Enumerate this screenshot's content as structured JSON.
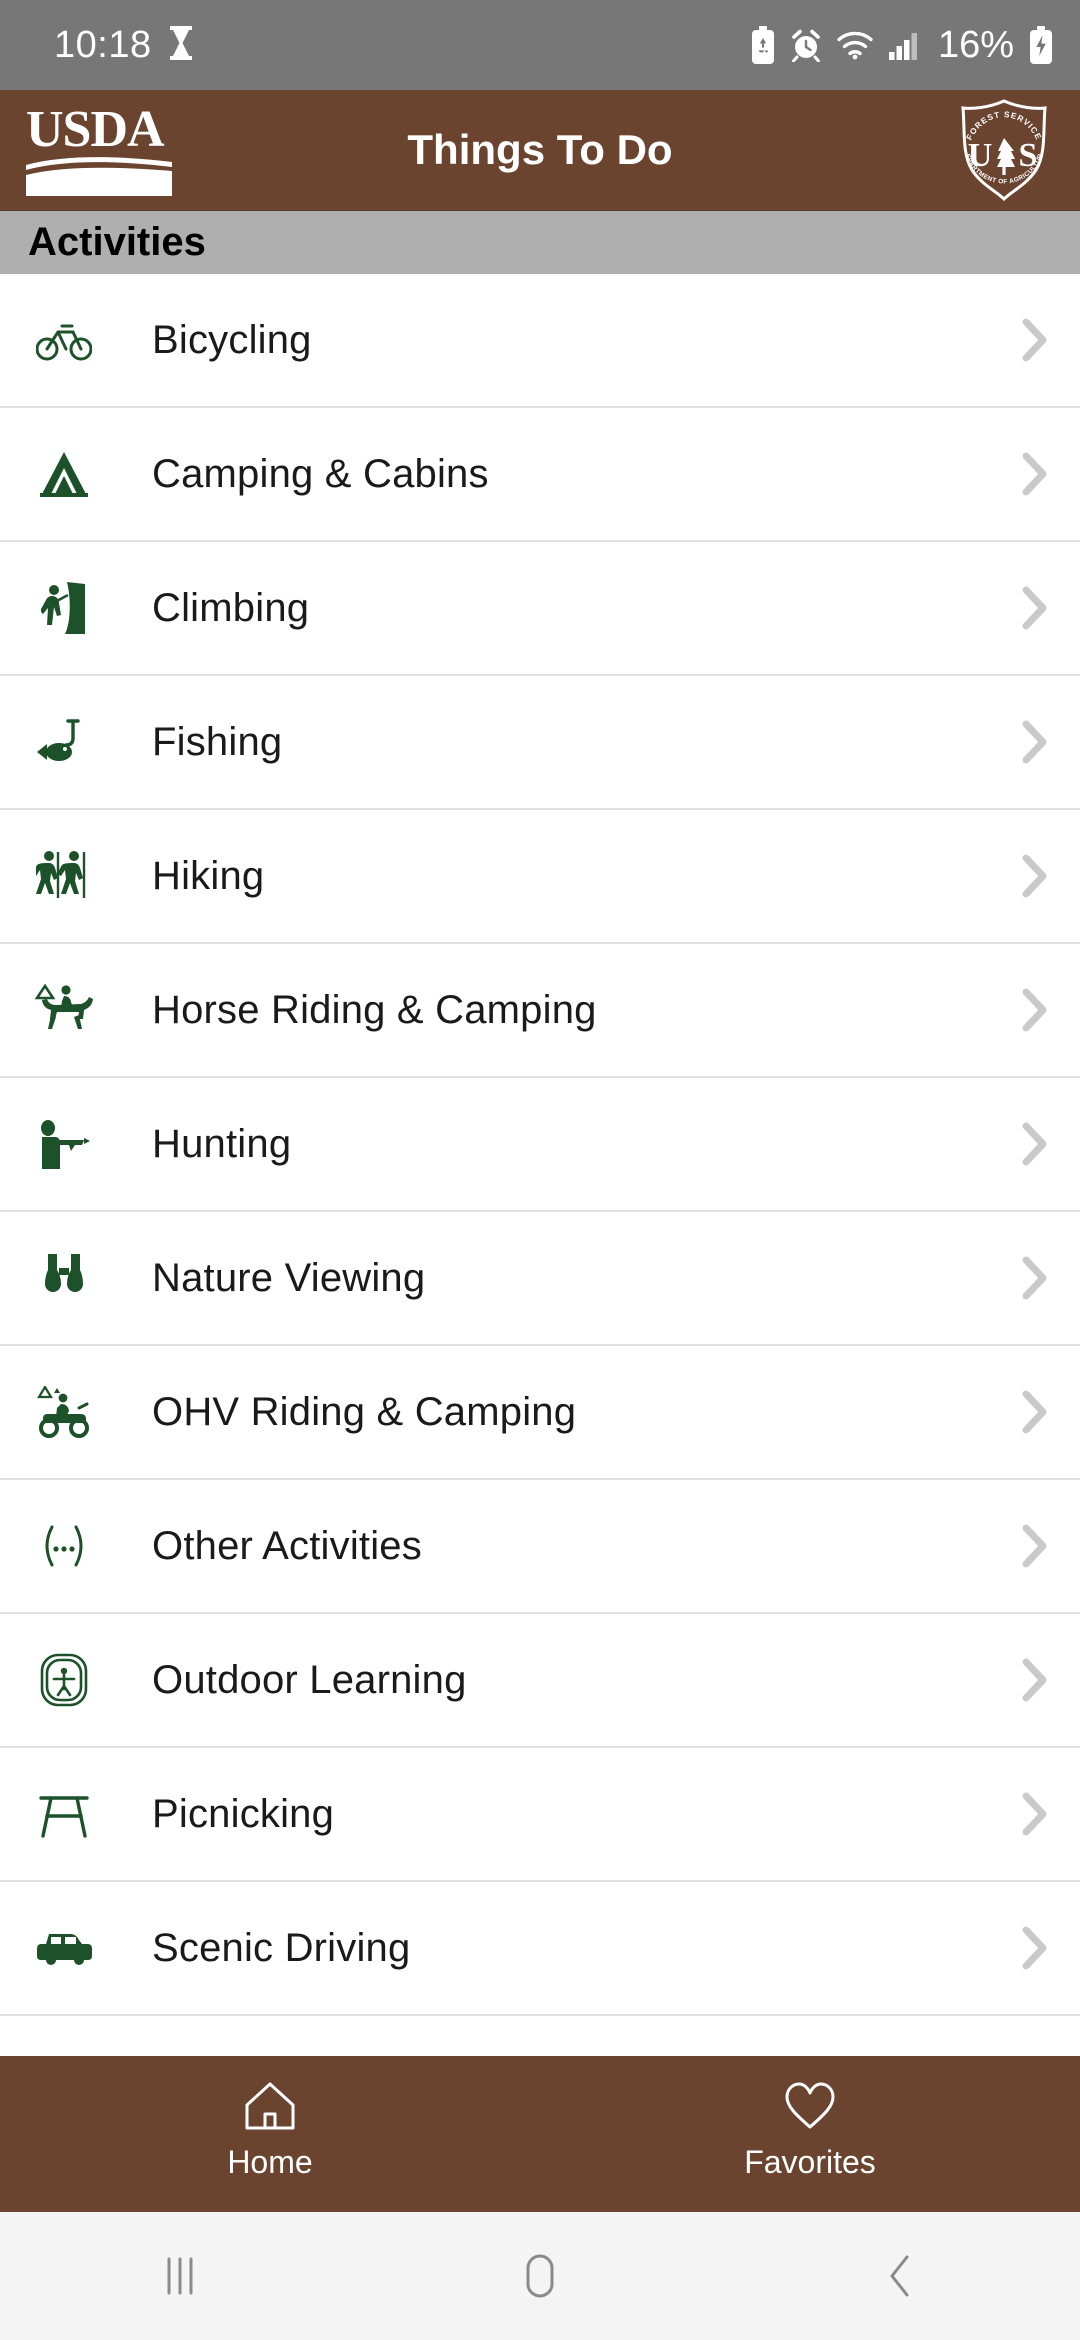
{
  "status_bar": {
    "time": "10:18",
    "battery_percent": "16%",
    "icons": [
      "hourglass-icon",
      "battery-saver-icon",
      "alarm-clock-icon",
      "wifi-icon",
      "cellular-signal-icon",
      "battery-charging-icon"
    ]
  },
  "app_bar": {
    "title": "Things To Do",
    "left_logo": "usda-logo",
    "left_logo_text": "USDA",
    "right_logo": "forest-service-shield-icon",
    "shield_top_text": "FOREST SERVICE",
    "shield_center_text": "US",
    "shield_bottom_text": "DEPARTMENT OF AGRICULTURE",
    "background_color": "#6B4430"
  },
  "section": {
    "title": "Activities",
    "background_color": "#AFAFAF"
  },
  "list": {
    "icon_color": "#1C5129",
    "chevron_color": "#c9c9c9",
    "items": [
      {
        "label": "Bicycling",
        "icon": "bicycle-icon"
      },
      {
        "label": "Camping & Cabins",
        "icon": "tent-icon"
      },
      {
        "label": "Climbing",
        "icon": "climber-icon"
      },
      {
        "label": "Fishing",
        "icon": "fish-hook-icon"
      },
      {
        "label": "Hiking",
        "icon": "hikers-icon"
      },
      {
        "label": "Horse Riding & Camping",
        "icon": "horse-rider-icon"
      },
      {
        "label": "Hunting",
        "icon": "hunter-rifle-icon"
      },
      {
        "label": "Nature Viewing",
        "icon": "binoculars-icon"
      },
      {
        "label": "OHV Riding & Camping",
        "icon": "atv-icon"
      },
      {
        "label": "Other Activities",
        "icon": "ellipsis-parentheses-icon"
      },
      {
        "label": "Outdoor Learning",
        "icon": "person-in-oval-icon"
      },
      {
        "label": "Picnicking",
        "icon": "picnic-table-icon"
      },
      {
        "label": "Scenic Driving",
        "icon": "car-icon"
      }
    ]
  },
  "tab_bar": {
    "background_color": "#6B4430",
    "tabs": [
      {
        "label": "Home",
        "icon": "home-icon"
      },
      {
        "label": "Favorites",
        "icon": "heart-icon"
      }
    ]
  },
  "nav_bar": {
    "buttons": [
      {
        "icon": "recents-icon"
      },
      {
        "icon": "home-circle-icon"
      },
      {
        "icon": "back-chevron-icon"
      }
    ]
  }
}
